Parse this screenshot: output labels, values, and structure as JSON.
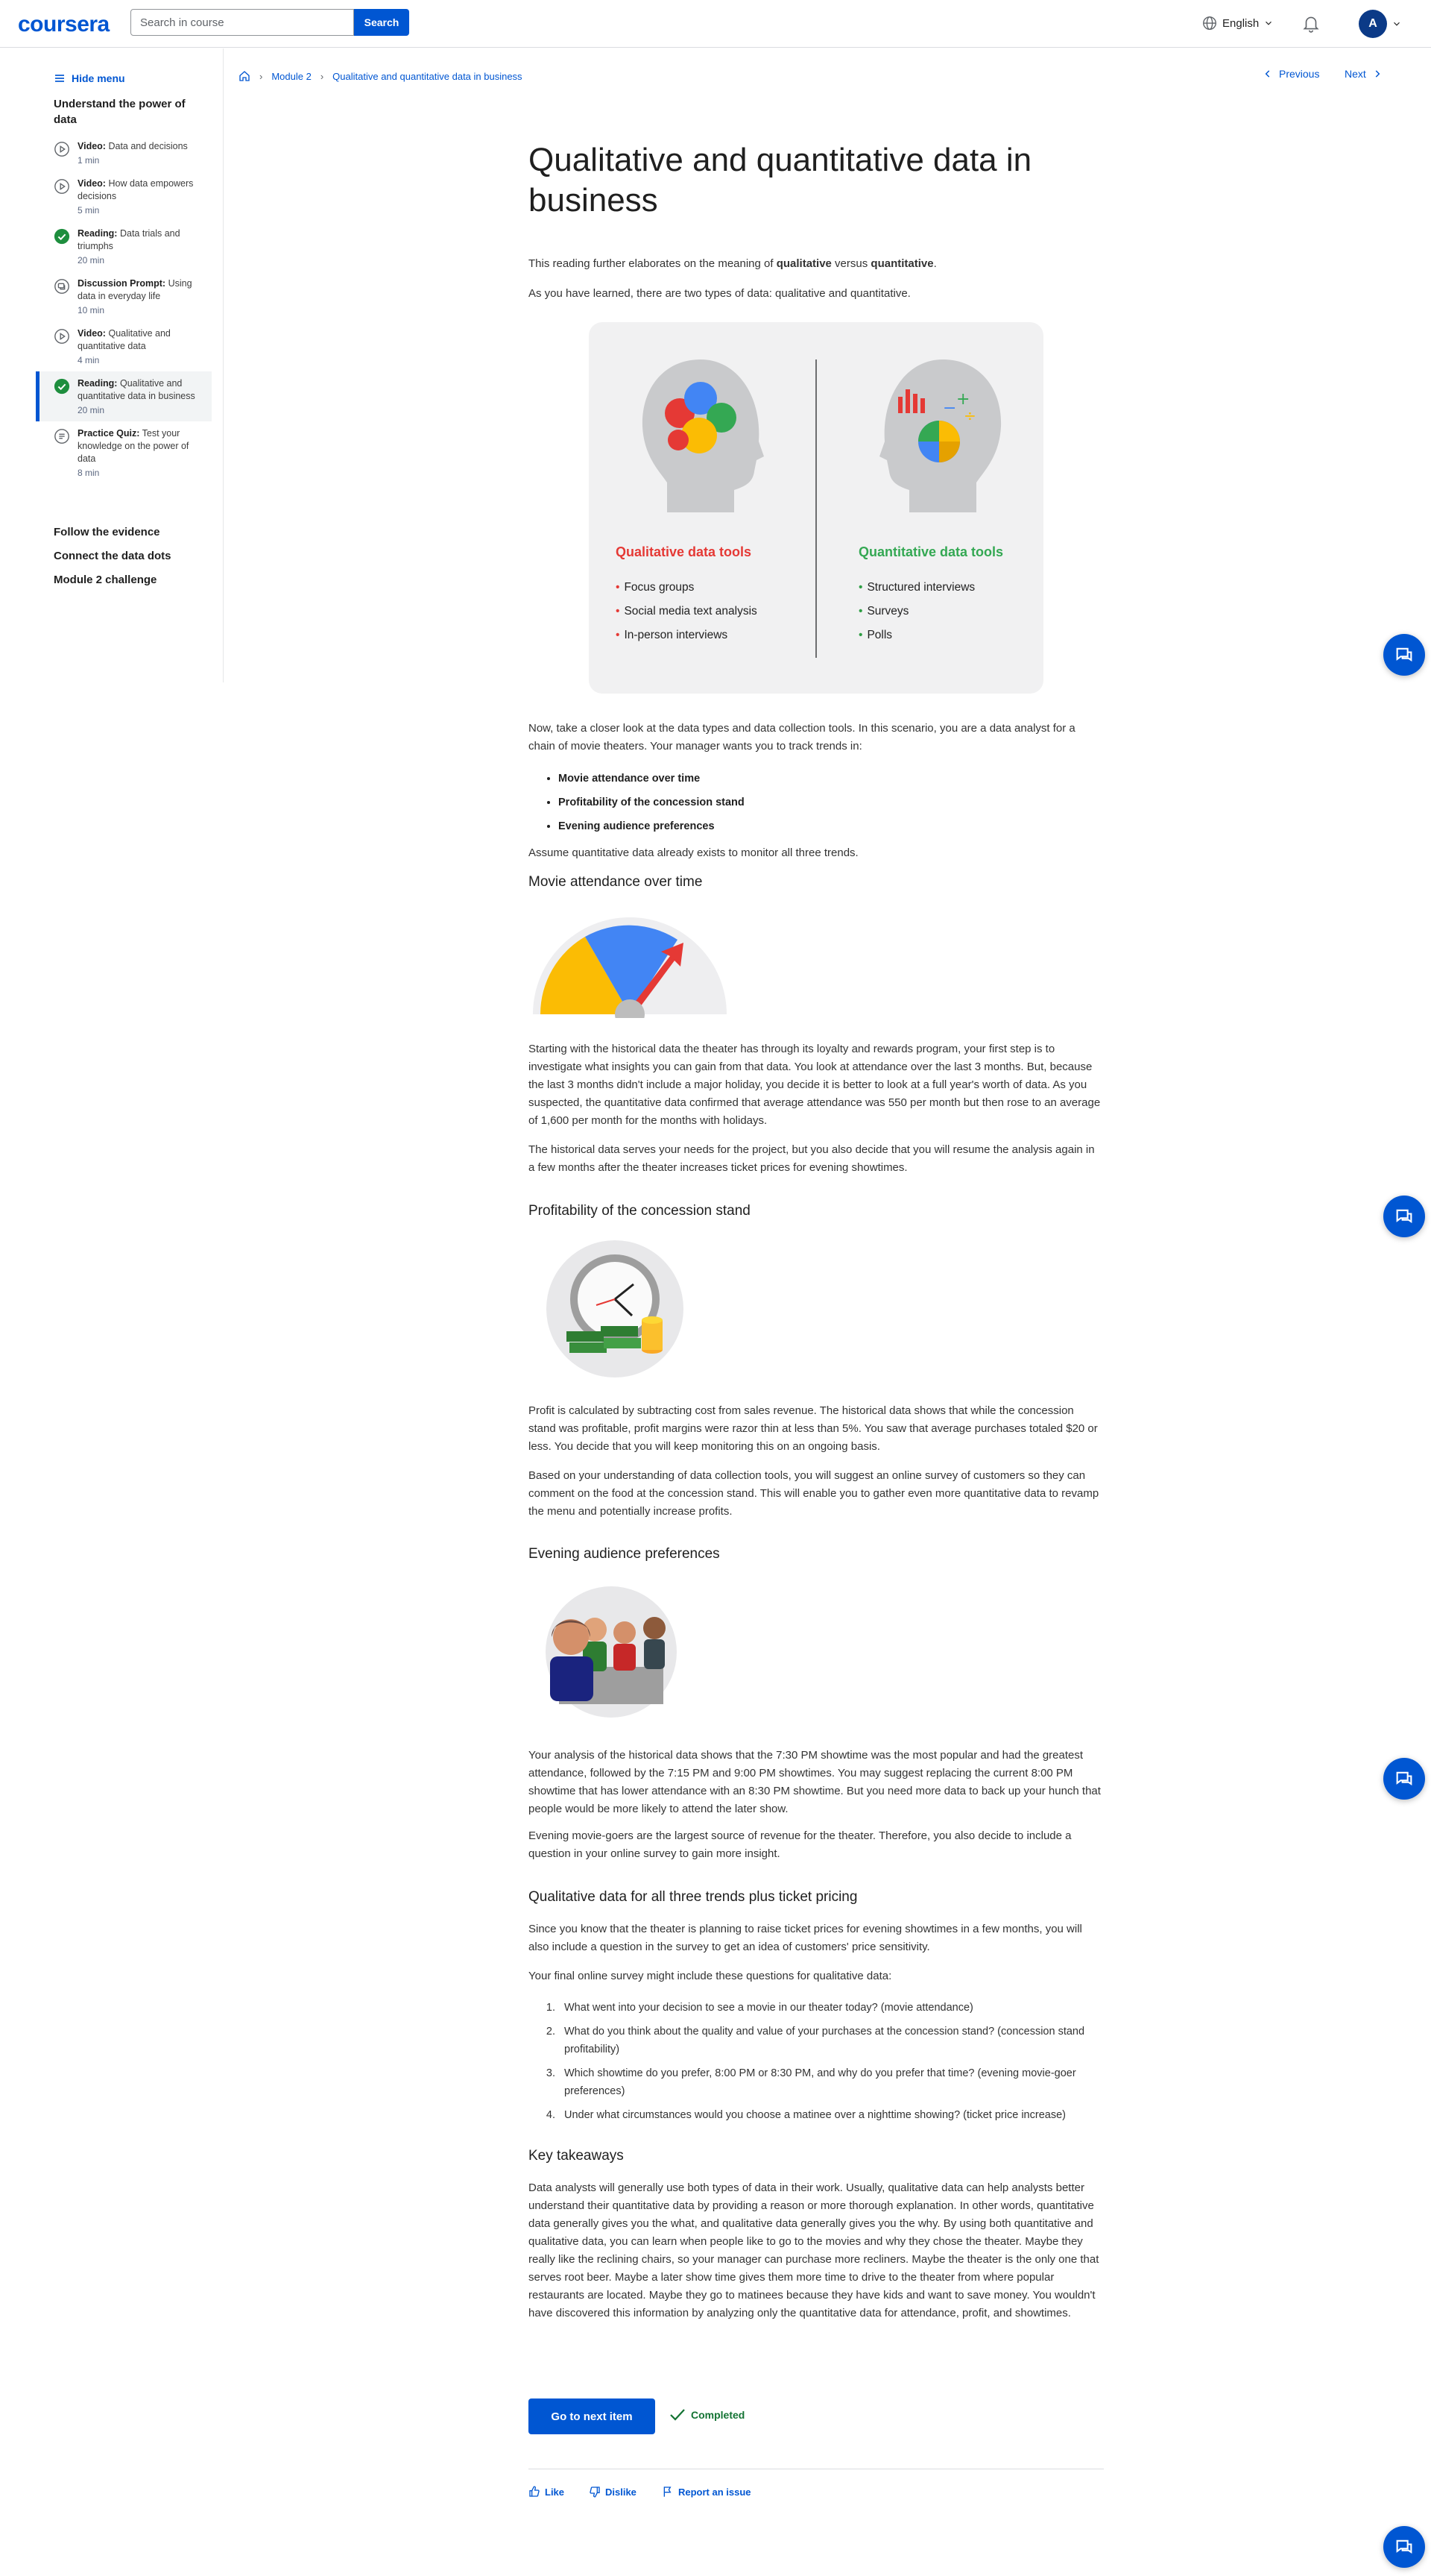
{
  "header": {
    "logo": "coursera",
    "search_placeholder": "Search in course",
    "search_button": "Search",
    "language": "English",
    "avatar_initial": "A"
  },
  "sidebar": {
    "hide_menu": "Hide menu",
    "module_title": "Understand the power of data",
    "items": [
      {
        "type": "Video:",
        "title": "Data and decisions",
        "time": "1 min",
        "icon": "play-icon",
        "status": "not-started"
      },
      {
        "type": "Video:",
        "title": "How data empowers decisions",
        "time": "5 min",
        "icon": "play-icon",
        "status": "not-started"
      },
      {
        "type": "Reading:",
        "title": "Data trials and triumphs",
        "time": "20 min",
        "icon": "check-circle-icon",
        "status": "completed"
      },
      {
        "type": "Discussion Prompt:",
        "title": "Using data in everyday life",
        "time": "10 min",
        "icon": "discussion-icon",
        "status": "not-started"
      },
      {
        "type": "Video:",
        "title": "Qualitative and quantitative data",
        "time": "4 min",
        "icon": "play-icon",
        "status": "not-started"
      },
      {
        "type": "Reading:",
        "title": "Qualitative and quantitative data in business",
        "time": "20 min",
        "icon": "check-circle-icon",
        "status": "completed"
      },
      {
        "type": "Practice Quiz:",
        "title": "Test your knowledge on the power of data",
        "time": "8 min",
        "icon": "quiz-icon",
        "status": "not-started"
      }
    ],
    "sections": [
      "Follow the evidence",
      "Connect the data dots",
      "Module 2 challenge"
    ]
  },
  "breadcrumb": {
    "module": "Module 2",
    "page": "Qualitative and quantitative data in business"
  },
  "nav": {
    "previous": "Previous",
    "next": "Next"
  },
  "article": {
    "title": "Qualitative and quantitative data in business",
    "intro_prefix": "This reading further elaborates on the meaning of ",
    "intro_bold1": "qualitative",
    "intro_mid": " versus ",
    "intro_bold2": "quantitative",
    "intro_suffix": ".",
    "p2": "As you have learned, there are two types of data: qualitative and quantitative.",
    "infographic": {
      "qual_title": "Qualitative data tools",
      "qual_items": [
        "Focus groups",
        "Social media text analysis",
        "In-person interviews"
      ],
      "quant_title": "Quantitative data tools",
      "quant_items": [
        "Structured interviews",
        "Surveys",
        "Polls"
      ],
      "qual_color": "#e53935",
      "quant_color": "#34a853"
    },
    "p3": "Now, take a closer look at the data types and data collection tools. In this scenario, you are a data analyst for a chain of movie theaters. Your manager wants you to track trends in:",
    "trends": [
      "Movie attendance over time",
      "Profitability of the concession stand",
      "Evening audience preferences"
    ],
    "p4": "Assume quantitative data already exists to monitor all three trends.",
    "h_attendance": "Movie attendance over time",
    "p_attendance1": "Starting with the historical data the theater has through its loyalty and rewards program, your first step is to investigate what insights you can gain from that data. You look at attendance over the last 3 months. But, because the last 3 months didn't include a major holiday, you decide it is better to look at a full year's worth of data. As you suspected, the quantitative data confirmed that average attendance was 550 per month but then rose to an average of 1,600 per month for the months with holidays.",
    "p_attendance2": "The historical data serves your needs for the project, but you also decide that you will resume the analysis again in a few months after the theater increases ticket prices for evening showtimes.",
    "h_profit": "Profitability of the concession stand",
    "p_profit1": "Profit is calculated by subtracting cost from sales revenue. The historical data shows that while the concession stand was profitable, profit margins were razor thin at less than 5%. You saw that average purchases totaled $20 or less. You decide that you will keep monitoring this on an ongoing basis.",
    "p_profit2": "Based on your understanding of data collection tools, you will suggest an online survey of customers so they can comment on the food at the concession stand. This will enable you to gather even more quantitative data to revamp the menu and potentially increase profits.",
    "h_evening": "Evening audience preferences",
    "p_evening1": "Your analysis of the historical data shows that the 7:30 PM showtime was the most popular and had the greatest attendance, followed by the 7:15 PM and 9:00 PM showtimes. You may suggest replacing the current 8:00 PM showtime that has lower attendance with an 8:30 PM showtime. But you need more data to back up your hunch that people would be more likely to attend the later show.",
    "p_evening2": "Evening movie-goers are the largest source of revenue for the theater. Therefore, you also decide to include a question in your online survey to gain more insight.",
    "h_qual": "Qualitative data for all three trends plus ticket pricing",
    "p_qual1": "Since you know that the theater is planning to raise ticket prices for evening showtimes in a few months, you will also include a question in the survey to get an idea of customers' price sensitivity.",
    "p_qual2": "Your final online survey might include these questions for qualitative data:",
    "questions": [
      "What went into your decision to see a movie in our theater today? (movie attendance)",
      "What do you think about the quality and value of your purchases at the concession stand? (concession stand profitability)",
      "Which showtime do you prefer, 8:00 PM or 8:30 PM, and why do you prefer that time? (evening movie-goer preferences)",
      "Under what circumstances would you choose a matinee over a nighttime showing? (ticket price increase)"
    ],
    "h_key": "Key takeaways",
    "p_key": "Data analysts will generally use both types of data in their work. Usually, qualitative data can help analysts better understand their quantitative data by providing a reason or more thorough explanation. In other words, quantitative data generally gives you the what, and qualitative data generally gives you the why. By using both quantitative and qualitative data, you can learn when people like to go to the movies and why they chose the theater. Maybe they really like the reclining chairs, so your manager can purchase more recliners. Maybe the theater is the only one that serves root beer. Maybe a later show time gives them more time to drive to the theater from where popular restaurants are located. Maybe they go to matinees because they have kids and want to save money. You wouldn't have discovered this information by analyzing only the quantitative data for attendance, profit, and showtimes."
  },
  "footer": {
    "next_button": "Go to next item",
    "completed": "Completed",
    "like": "Like",
    "dislike": "Dislike",
    "report": "Report an issue"
  },
  "colors": {
    "brand": "#0056d2",
    "completed_green": "#137333"
  }
}
